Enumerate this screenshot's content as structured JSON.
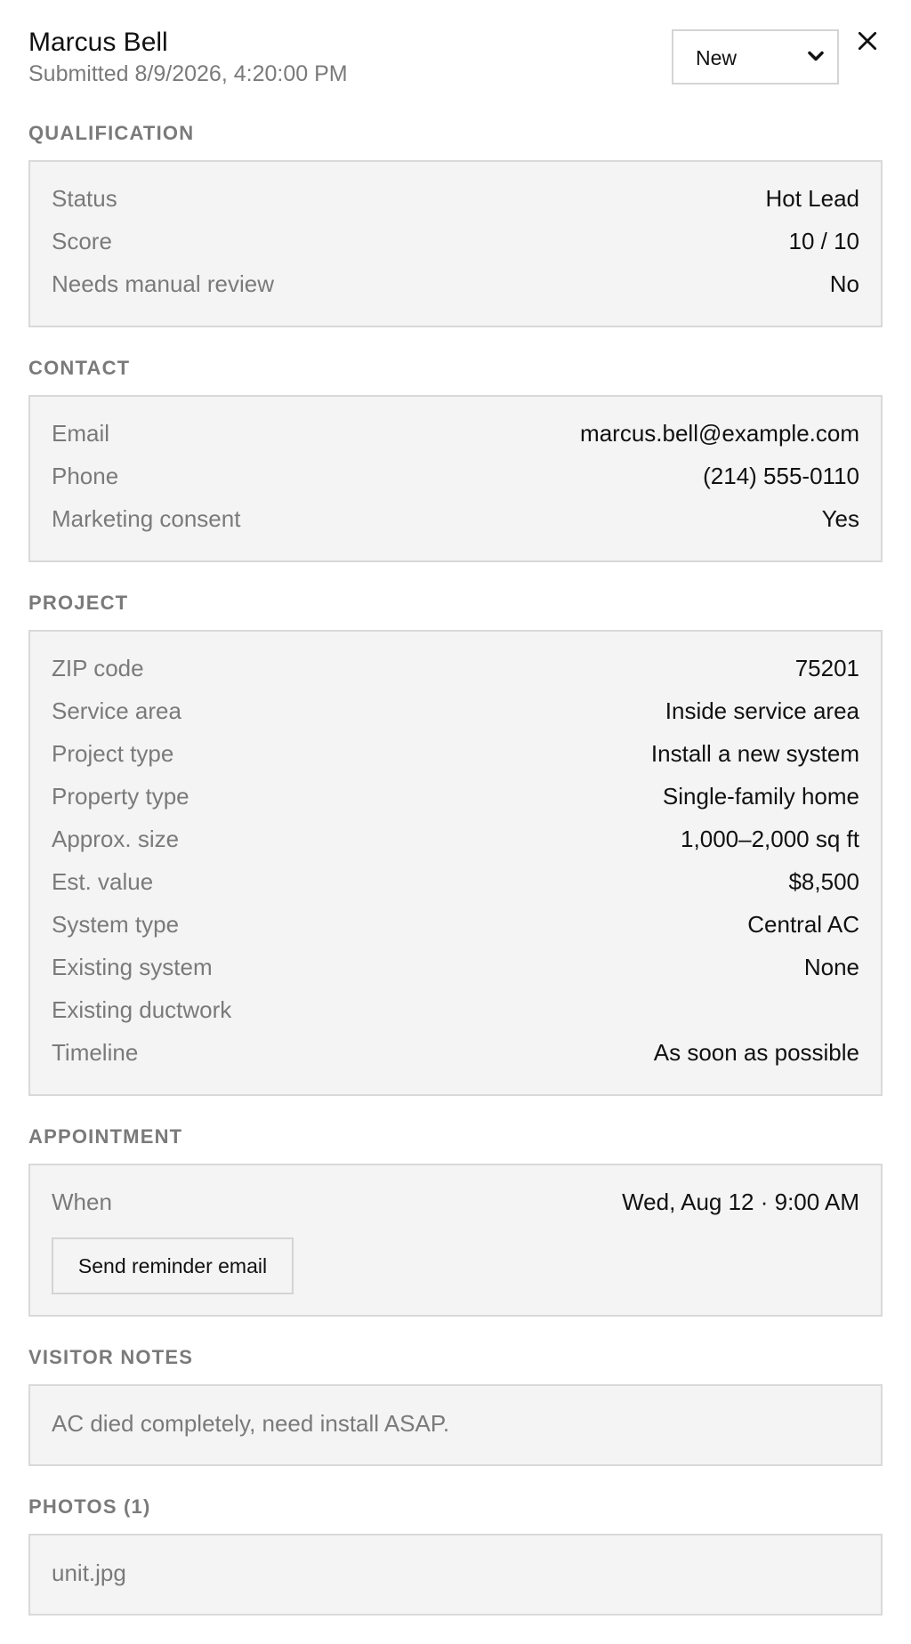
{
  "header": {
    "name": "Marcus Bell",
    "submitted": "Submitted 8/9/2026, 4:20:00 PM",
    "status_value": "New",
    "close_glyph": "×"
  },
  "sections": {
    "qualification": {
      "label": "QUALIFICATION",
      "rows": [
        {
          "key": "Status",
          "value": "Hot Lead"
        },
        {
          "key": "Score",
          "value": "10 / 10"
        },
        {
          "key": "Needs manual review",
          "value": "No"
        }
      ]
    },
    "contact": {
      "label": "CONTACT",
      "rows": [
        {
          "key": "Email",
          "value": "marcus.bell@example.com"
        },
        {
          "key": "Phone",
          "value": "(214) 555-0110"
        },
        {
          "key": "Marketing consent",
          "value": "Yes"
        }
      ]
    },
    "project": {
      "label": "PROJECT",
      "rows": [
        {
          "key": "ZIP code",
          "value": "75201"
        },
        {
          "key": "Service area",
          "value": "Inside service area"
        },
        {
          "key": "Project type",
          "value": "Install a new system"
        },
        {
          "key": "Property type",
          "value": "Single-family home"
        },
        {
          "key": "Approx. size",
          "value": "1,000–2,000 sq ft"
        },
        {
          "key": "Est. value",
          "value": "$8,500"
        },
        {
          "key": "System type",
          "value": "Central AC"
        },
        {
          "key": "Existing system",
          "value": "None"
        },
        {
          "key": "Existing ductwork",
          "value": ""
        },
        {
          "key": "Timeline",
          "value": "As soon as possible"
        }
      ]
    },
    "appointment": {
      "label": "APPOINTMENT",
      "when_key": "When",
      "when_value": "Wed, Aug 12 · 9:00 AM",
      "reminder_button": "Send reminder email"
    },
    "visitor_notes": {
      "label": "VISITOR NOTES",
      "text": "AC died completely, need install ASAP."
    },
    "photos": {
      "label": "PHOTOS (1)",
      "files": [
        "unit.jpg"
      ]
    }
  },
  "icons": {
    "close": "close-icon",
    "dropdown": "chevron-down-icon"
  },
  "colors": {
    "text_primary": "#111111",
    "text_muted": "#7a7a7a",
    "card_bg": "#f4f4f4",
    "card_border": "#d9d9d9"
  }
}
